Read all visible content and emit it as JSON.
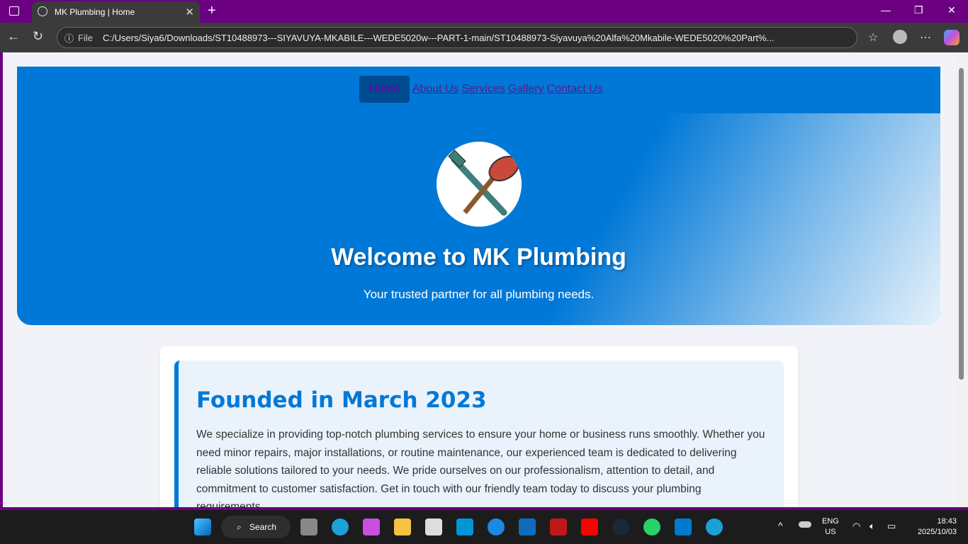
{
  "browser": {
    "tab_title": "MK Plumbing | Home",
    "address_label": "File",
    "url": "C:/Users/Siya6/Downloads/ST10488973---SIYAVUYA-MKABILE---WEDE5020w---PART-1-main/ST10488973-Siyavuya%20Alfa%20Mkabile-WEDE5020%20Part%..."
  },
  "nav": [
    {
      "label": "Home"
    },
    {
      "label": "About Us"
    },
    {
      "label": "Services"
    },
    {
      "label": "Gallery"
    },
    {
      "label": "Contact Us"
    }
  ],
  "hero": {
    "title": "Welcome to MK Plumbing",
    "subtitle": "Your trusted partner for all plumbing needs."
  },
  "about": {
    "heading": "Founded in March 2023",
    "body": "We specialize in providing top-notch plumbing services to ensure your home or business runs smoothly. Whether you need minor repairs, major installations, or routine maintenance, our experienced team is dedicated to delivering reliable solutions tailored to your needs. We pride ourselves on our professionalism, attention to detail, and commitment to customer satisfaction. Get in touch with our friendly team today to discuss your plumbing requirements"
  },
  "taskbar": {
    "search": "Search",
    "lang1": "ENG",
    "lang2": "US",
    "time": "18:43",
    "date": "2025/10/03"
  },
  "colors": {
    "accent": "#0078d7",
    "titlebar": "#6b0080"
  }
}
